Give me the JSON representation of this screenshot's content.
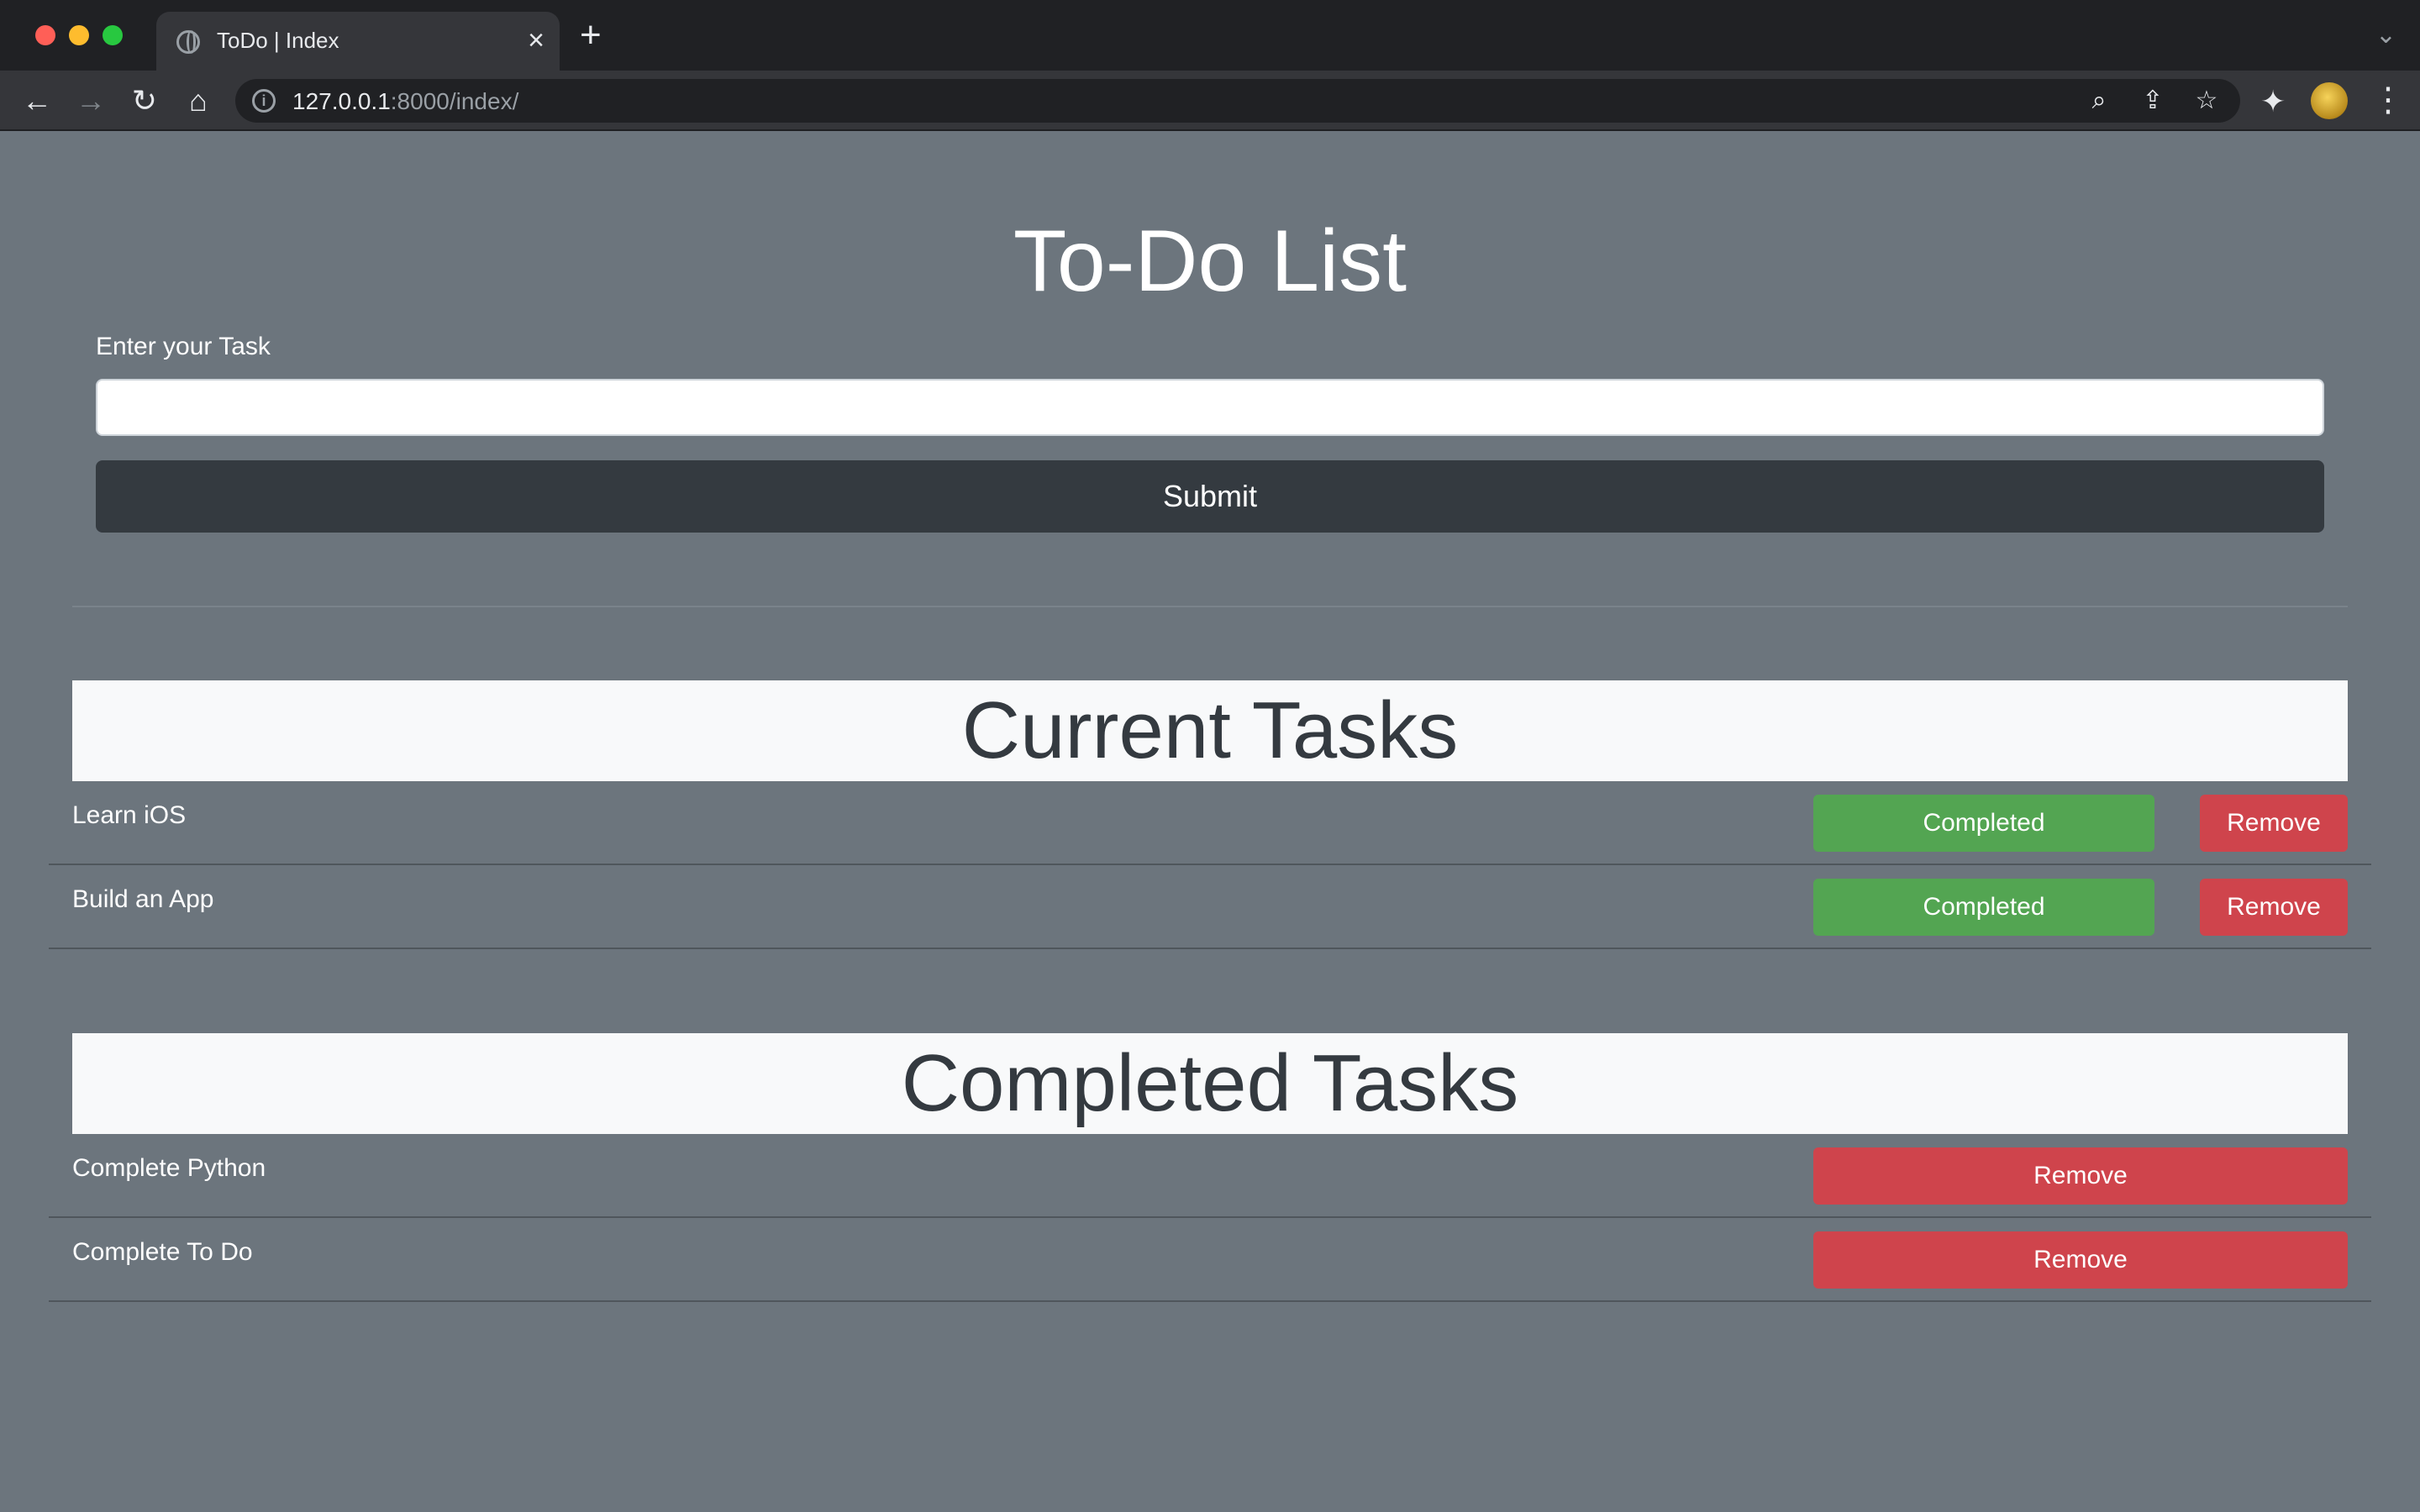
{
  "browser": {
    "tab_title": "ToDo | Index",
    "tab_close": "×",
    "new_tab": "+",
    "tabs_menu": "⌄",
    "url_host": "127.0.0.1",
    "url_rest": ":8000/index/",
    "icons": [
      "back-icon",
      "forward-icon",
      "reload-icon",
      "home-icon",
      "info-icon",
      "zoom-icon",
      "share-icon",
      "star-icon",
      "extensions-icon",
      "kebab-menu-icon"
    ]
  },
  "page": {
    "title": "To-Do List",
    "input_label": "Enter your Task",
    "input_value": "",
    "submit_label": "Submit"
  },
  "current": {
    "header": "Current Tasks",
    "items": [
      {
        "text": "Learn iOS",
        "complete_label": "Completed",
        "remove_label": "Remove"
      },
      {
        "text": "Build an App",
        "complete_label": "Completed",
        "remove_label": "Remove"
      }
    ]
  },
  "completed": {
    "header": "Completed Tasks",
    "items": [
      {
        "text": "Complete Python",
        "remove_label": "Remove"
      },
      {
        "text": "Complete To Do",
        "remove_label": "Remove"
      }
    ]
  },
  "colors": {
    "page_bg": "#6c757d",
    "submit_bg": "#343a40",
    "success": "#53a552",
    "danger": "#cf444c",
    "header_bg": "#f8f9fa"
  }
}
